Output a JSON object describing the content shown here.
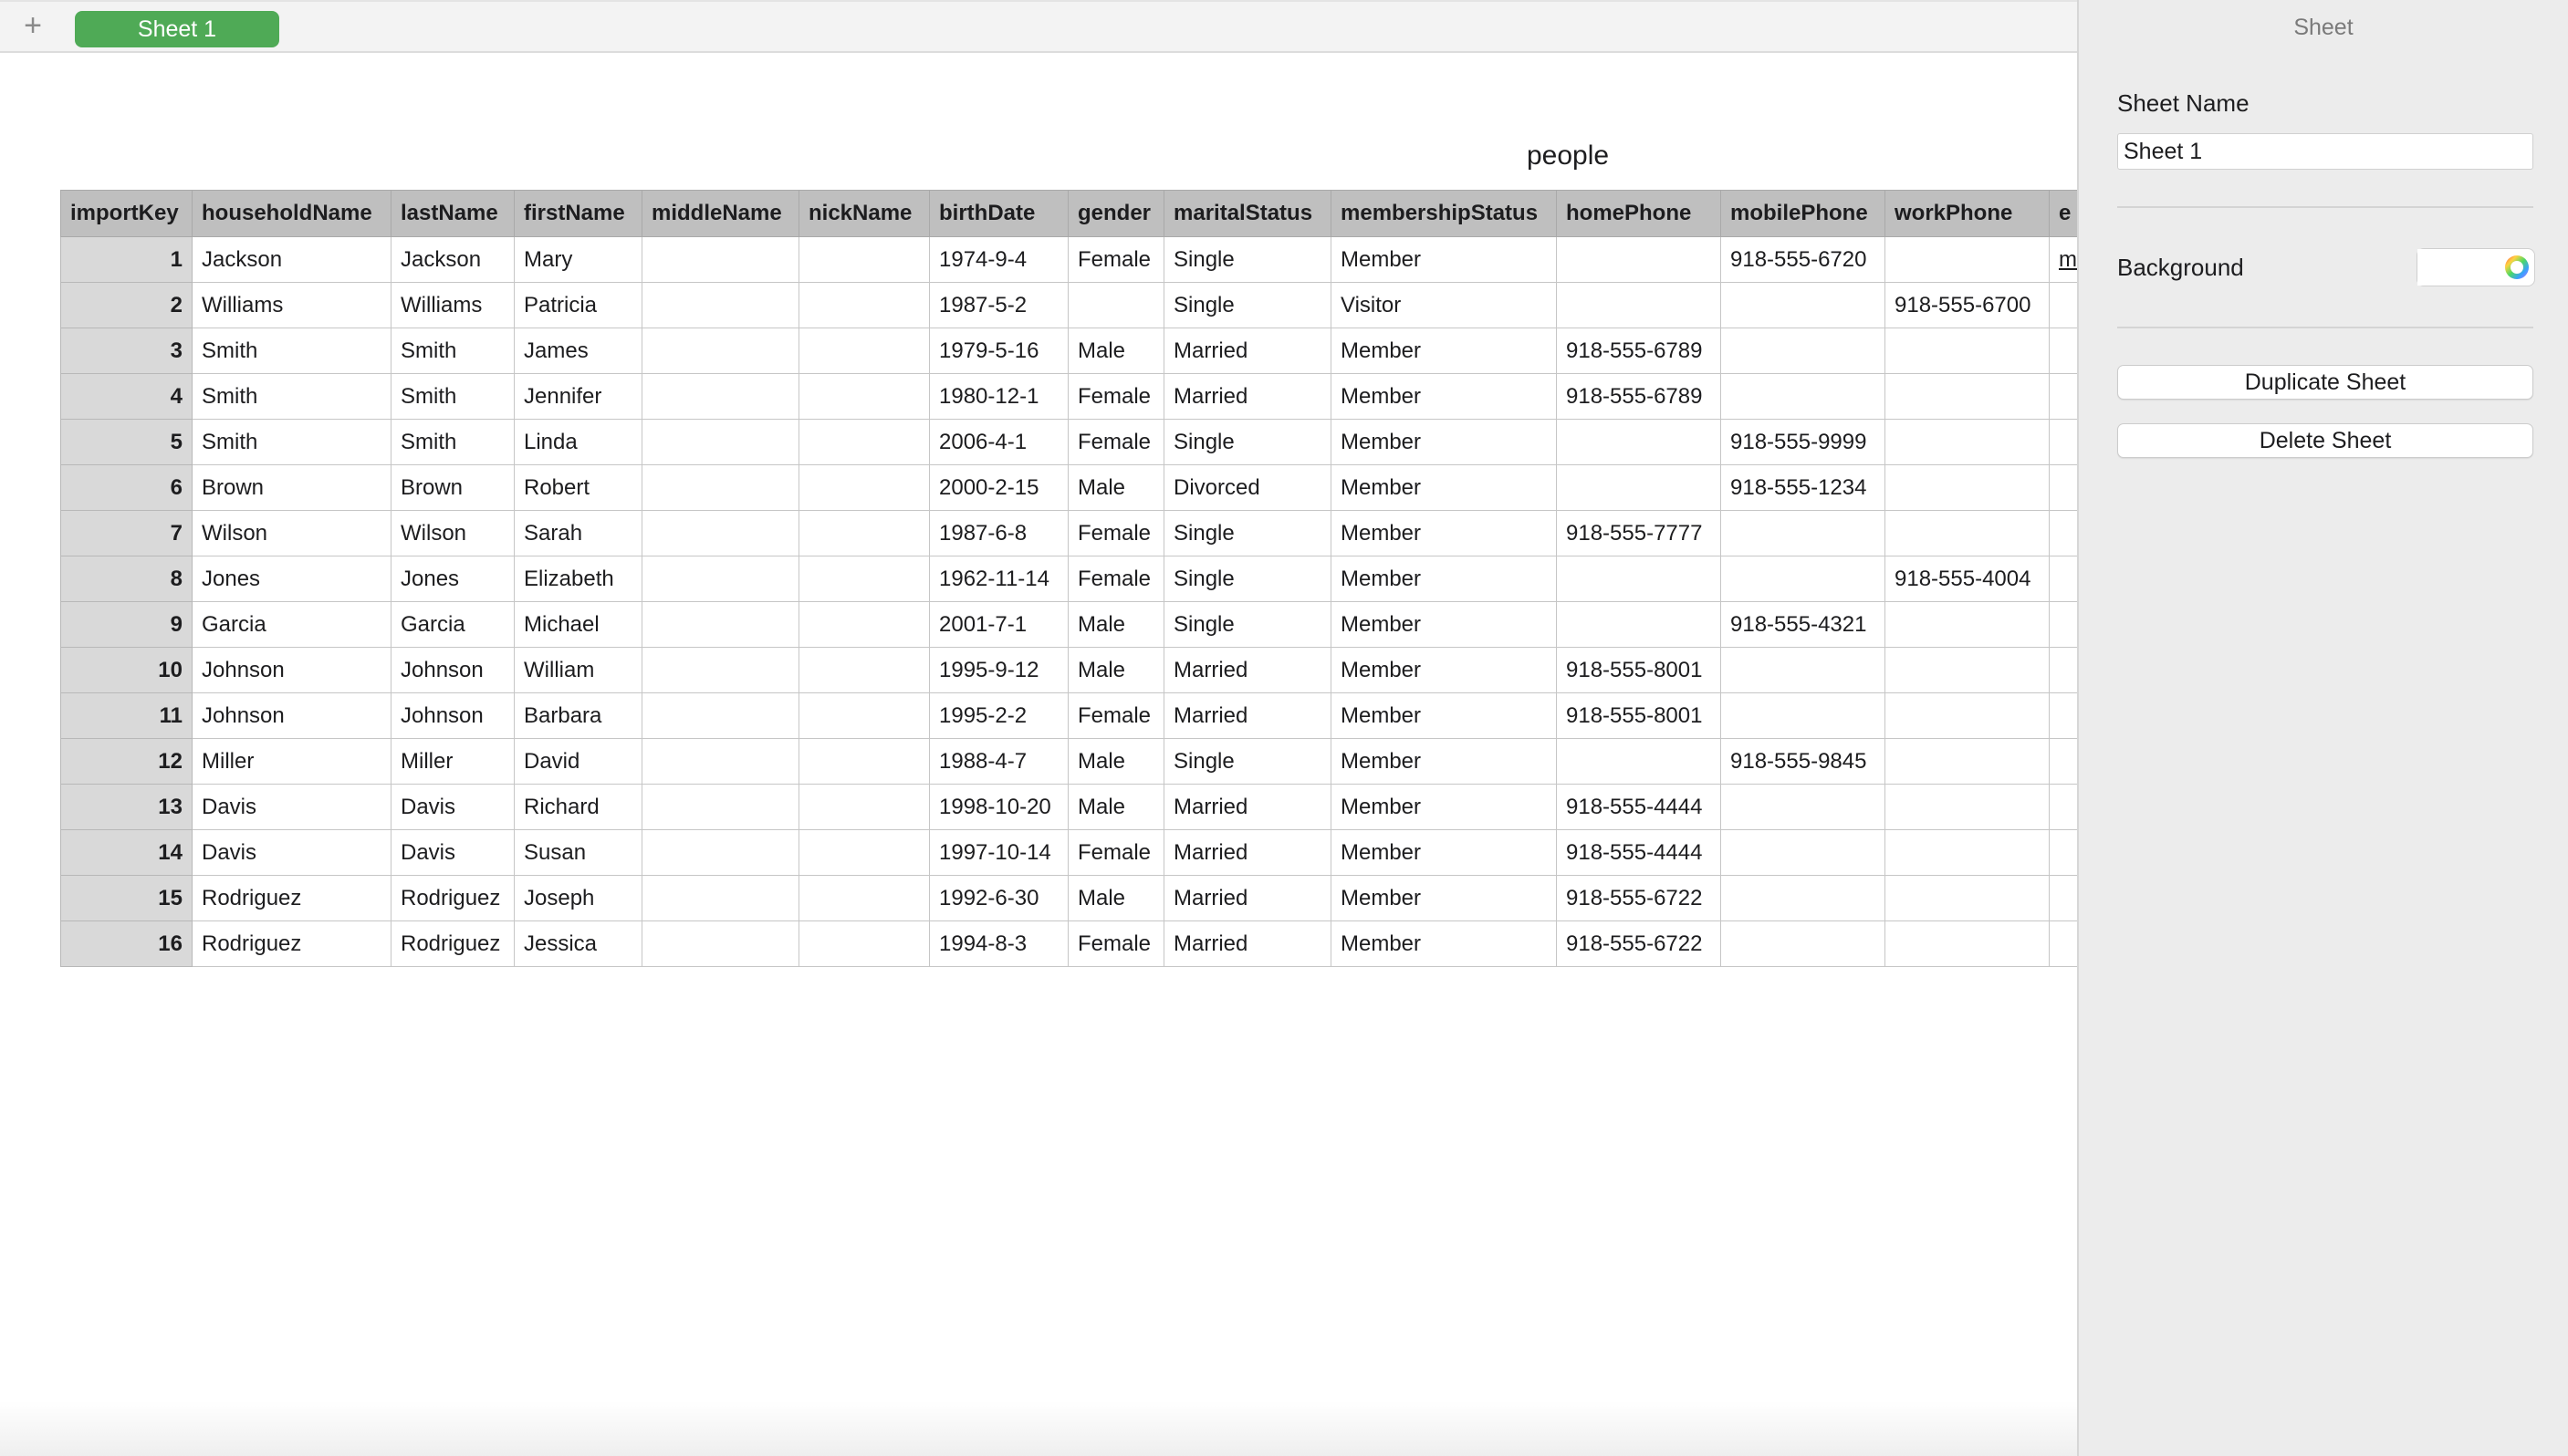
{
  "tabbar": {
    "add_icon": "+",
    "active_tab": "Sheet 1"
  },
  "table": {
    "title": "people",
    "columns": [
      "importKey",
      "householdName",
      "lastName",
      "firstName",
      "middleName",
      "nickName",
      "birthDate",
      "gender",
      "maritalStatus",
      "membershipStatus",
      "homePhone",
      "mobilePhone",
      "workPhone",
      "email"
    ],
    "visible_partial_last_header": "e",
    "rows": [
      [
        "1",
        "Jackson",
        "Jackson",
        "Mary",
        "",
        "",
        "1974-9-4",
        "Female",
        "Single",
        "Member",
        "",
        "918-555-6720",
        "",
        "m"
      ],
      [
        "2",
        "Williams",
        "Williams",
        "Patricia",
        "",
        "",
        "1987-5-2",
        "",
        "Single",
        "Visitor",
        "",
        "",
        "918-555-6700",
        ""
      ],
      [
        "3",
        "Smith",
        "Smith",
        "James",
        "",
        "",
        "1979-5-16",
        "Male",
        "Married",
        "Member",
        "918-555-6789",
        "",
        "",
        ""
      ],
      [
        "4",
        "Smith",
        "Smith",
        "Jennifer",
        "",
        "",
        "1980-12-1",
        "Female",
        "Married",
        "Member",
        "918-555-6789",
        "",
        "",
        ""
      ],
      [
        "5",
        "Smith",
        "Smith",
        "Linda",
        "",
        "",
        "2006-4-1",
        "Female",
        "Single",
        "Member",
        "",
        "918-555-9999",
        "",
        ""
      ],
      [
        "6",
        "Brown",
        "Brown",
        "Robert",
        "",
        "",
        "2000-2-15",
        "Male",
        "Divorced",
        "Member",
        "",
        "918-555-1234",
        "",
        ""
      ],
      [
        "7",
        "Wilson",
        "Wilson",
        "Sarah",
        "",
        "",
        "1987-6-8",
        "Female",
        "Single",
        "Member",
        "918-555-7777",
        "",
        "",
        ""
      ],
      [
        "8",
        "Jones",
        "Jones",
        "Elizabeth",
        "",
        "",
        "1962-11-14",
        "Female",
        "Single",
        "Member",
        "",
        "",
        "918-555-4004",
        ""
      ],
      [
        "9",
        "Garcia",
        "Garcia",
        "Michael",
        "",
        "",
        "2001-7-1",
        "Male",
        "Single",
        "Member",
        "",
        "918-555-4321",
        "",
        ""
      ],
      [
        "10",
        "Johnson",
        "Johnson",
        "William",
        "",
        "",
        "1995-9-12",
        "Male",
        "Married",
        "Member",
        "918-555-8001",
        "",
        "",
        ""
      ],
      [
        "11",
        "Johnson",
        "Johnson",
        "Barbara",
        "",
        "",
        "1995-2-2",
        "Female",
        "Married",
        "Member",
        "918-555-8001",
        "",
        "",
        ""
      ],
      [
        "12",
        "Miller",
        "Miller",
        "David",
        "",
        "",
        "1988-4-7",
        "Male",
        "Single",
        "Member",
        "",
        "918-555-9845",
        "",
        ""
      ],
      [
        "13",
        "Davis",
        "Davis",
        "Richard",
        "",
        "",
        "1998-10-20",
        "Male",
        "Married",
        "Member",
        "918-555-4444",
        "",
        "",
        ""
      ],
      [
        "14",
        "Davis",
        "Davis",
        "Susan",
        "",
        "",
        "1997-10-14",
        "Female",
        "Married",
        "Member",
        "918-555-4444",
        "",
        "",
        ""
      ],
      [
        "15",
        "Rodriguez",
        "Rodriguez",
        "Joseph",
        "",
        "",
        "1992-6-30",
        "Male",
        "Married",
        "Member",
        "918-555-6722",
        "",
        "",
        ""
      ],
      [
        "16",
        "Rodriguez",
        "Rodriguez",
        "Jessica",
        "",
        "",
        "1994-8-3",
        "Female",
        "Married",
        "Member",
        "918-555-6722",
        "",
        "",
        ""
      ]
    ]
  },
  "inspector": {
    "title": "Sheet",
    "sheet_name_label": "Sheet Name",
    "sheet_name_value": "Sheet 1",
    "background_label": "Background",
    "background_color": "#ffffff",
    "color_wheel_icon": "color-wheel-icon",
    "duplicate_label": "Duplicate Sheet",
    "delete_label": "Delete Sheet"
  },
  "colors": {
    "tab_active": "#4faa56",
    "header_bg": "#bfbfbf",
    "rowkey_bg": "#d9d9d9",
    "sidebar_bg": "#ececec"
  }
}
